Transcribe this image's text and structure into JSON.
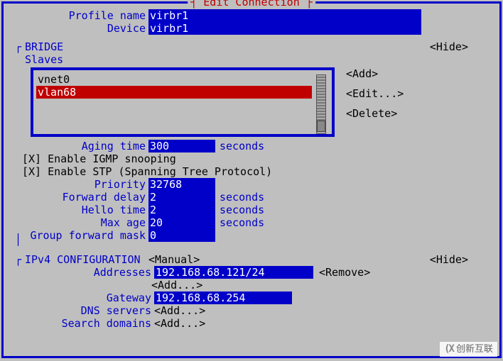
{
  "frame_title": "┤ Edit Connection ├",
  "profile": {
    "name_label": "Profile name",
    "name_value": "virbr1",
    "device_label": "Device",
    "device_value": "virbr1"
  },
  "bridge": {
    "title": "BRIDGE",
    "subtitle": "Slaves",
    "hide": "<Hide>",
    "slaves": [
      {
        "text": "vnet0",
        "selected": false
      },
      {
        "text": "vlan68",
        "selected": true
      }
    ],
    "actions": {
      "add": "<Add>",
      "edit": "<Edit...>",
      "delete": "<Delete>"
    },
    "aging_label": "Aging time",
    "aging_value": "300",
    "aging_unit": "seconds",
    "igmp": "[X] Enable IGMP snooping",
    "stp": "[X] Enable STP (Spanning Tree Protocol)",
    "priority_label": "Priority",
    "priority_value": "32768",
    "fdelay_label": "Forward delay",
    "fdelay_value": "2",
    "fdelay_unit": "seconds",
    "hello_label": "Hello time",
    "hello_value": "2",
    "hello_unit": "seconds",
    "maxage_label": "Max age",
    "maxage_value": "20",
    "maxage_unit": "seconds",
    "gfwdmask_label": "Group forward mask",
    "gfwdmask_value": "0"
  },
  "ipv4": {
    "title": "IPv4 CONFIGURATION",
    "mode": "<Manual>",
    "hide": "<Hide>",
    "addresses_label": "Addresses",
    "address_value": "192.168.68.121/24",
    "remove": "<Remove>",
    "add_addr": "<Add...>",
    "gateway_label": "Gateway",
    "gateway_value": "192.168.68.254",
    "dns_label": "DNS servers",
    "dns_add": "<Add...>",
    "search_label": "Search domains",
    "search_add": "<Add...>"
  },
  "watermark": "创新互联"
}
